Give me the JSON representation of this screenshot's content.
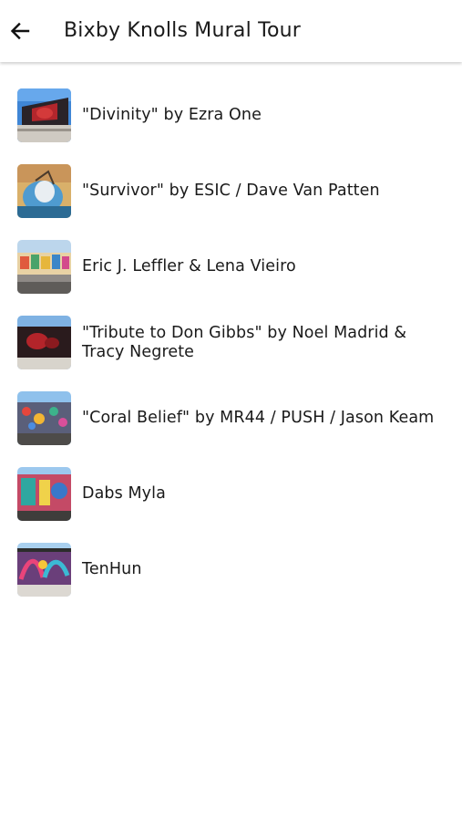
{
  "header": {
    "title": "Bixby Knolls Mural Tour",
    "back_icon": "arrow-left-icon"
  },
  "murals": [
    {
      "title": "\"Divinity\" by Ezra One",
      "thumbnail": "mural-thumbnail-divinity"
    },
    {
      "title": "\"Survivor\" by ESIC / Dave Van Patten",
      "thumbnail": "mural-thumbnail-survivor"
    },
    {
      "title": "Eric J. Leffler & Lena Vieiro",
      "thumbnail": "mural-thumbnail-leffler-vieiro"
    },
    {
      "title": "\"Tribute to Don Gibbs\" by Noel Madrid & Tracy Negrete",
      "thumbnail": "mural-thumbnail-don-gibbs"
    },
    {
      "title": "\"Coral Belief\" by MR44 / PUSH / Jason Keam",
      "thumbnail": "mural-thumbnail-coral-belief"
    },
    {
      "title": "Dabs Myla",
      "thumbnail": "mural-thumbnail-dabs-myla"
    },
    {
      "title": "TenHun",
      "thumbnail": "mural-thumbnail-tenhun"
    }
  ]
}
